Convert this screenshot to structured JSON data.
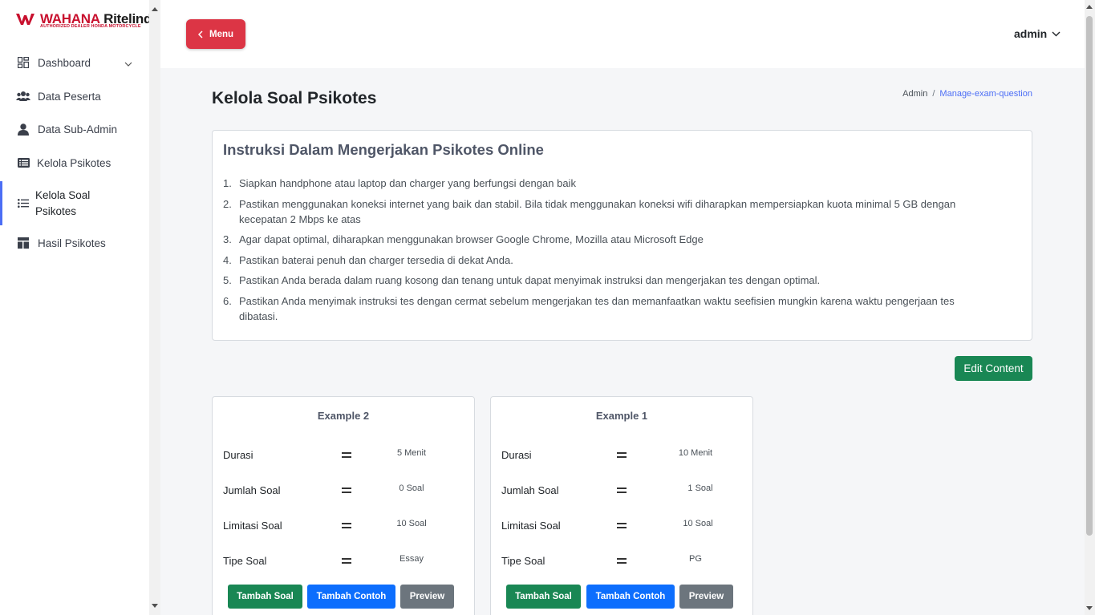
{
  "brand": {
    "name_red": "WAHANA",
    "name_dark": " Ritelindo",
    "tagline": "AUTHORIZED DEALER HONDA MOTORCYCLE",
    "mini": "WAHANA RITELINDO"
  },
  "sidebar": {
    "items": [
      {
        "label": "Dashboard",
        "icon": "grid-icon"
      },
      {
        "label": "Data Peserta",
        "icon": "users-icon"
      },
      {
        "label": "Data Sub-Admin",
        "icon": "user-icon"
      },
      {
        "label": "Kelola Psikotes",
        "icon": "list-icon"
      },
      {
        "label": "Kelola Soal",
        "label2": "Psikotes",
        "icon": "list-ul-icon"
      },
      {
        "label": "Hasil Psikotes",
        "icon": "table-icon"
      }
    ]
  },
  "header": {
    "menu_label": "Menu",
    "user": "admin"
  },
  "page": {
    "title": "Kelola Soal Psikotes",
    "breadcrumb": [
      "Admin",
      "/",
      "Manage-exam-question"
    ]
  },
  "instructions": {
    "title": "Instruksi Dalam Mengerjakan Psikotes Online",
    "items": [
      {
        "num": "1.",
        "text": "Siapkan handphone atau laptop dan charger yang berfungsi dengan baik"
      },
      {
        "num": "2.",
        "text": "Pastikan menggunakan koneksi internet yang baik dan stabil. Bila tidak menggunakan koneksi wifi diharapkan mempersiapkan kuota minimal 5 GB dengan kecepatan 2 Mbps ke atas"
      },
      {
        "num": "3.",
        "text": "Agar dapat optimal, diharapkan menggunakan browser Google Chrome, Mozilla atau Microsoft Edge"
      },
      {
        "num": "4.",
        "text": "Pastikan baterai penuh dan charger tersedia di dekat Anda."
      },
      {
        "num": "5.",
        "text": "Pastikan Anda berada dalam ruang kosong dan tenang untuk dapat menyimak instruksi dan mengerjakan tes dengan optimal."
      },
      {
        "num": "6.",
        "text": "Pastikan Anda menyimak instruksi tes dengan cermat sebelum mengerjakan tes dan memanfaatkan waktu seefisien mungkin karena waktu pengerjaan tes dibatasi."
      }
    ],
    "edit_label": "Edit Content"
  },
  "examples": [
    {
      "title": "Example 2",
      "rows": [
        {
          "k": "Durasi",
          "v": "5 Menit"
        },
        {
          "k": "Jumlah Soal",
          "v": "0 Soal"
        },
        {
          "k": "Limitasi Soal",
          "v": "10 Soal"
        },
        {
          "k": "Tipe Soal",
          "v": "Essay"
        }
      ],
      "buttons": [
        "Tambah Soal",
        "Tambah Contoh",
        "Preview"
      ]
    },
    {
      "title": "Example 1",
      "rows": [
        {
          "k": "Durasi",
          "v": "10 Menit"
        },
        {
          "k": "Jumlah Soal",
          "v": "1 Soal"
        },
        {
          "k": "Limitasi Soal",
          "v": "10 Soal"
        },
        {
          "k": "Tipe Soal",
          "v": "PG"
        }
      ],
      "buttons": [
        "Tambah Soal",
        "Tambah Contoh",
        "Preview"
      ]
    }
  ],
  "colors": {
    "accent": "#4c6ef5",
    "danger": "#dc3545",
    "success": "#198754",
    "primary": "#0d6efd",
    "secondary": "#6c757d"
  }
}
